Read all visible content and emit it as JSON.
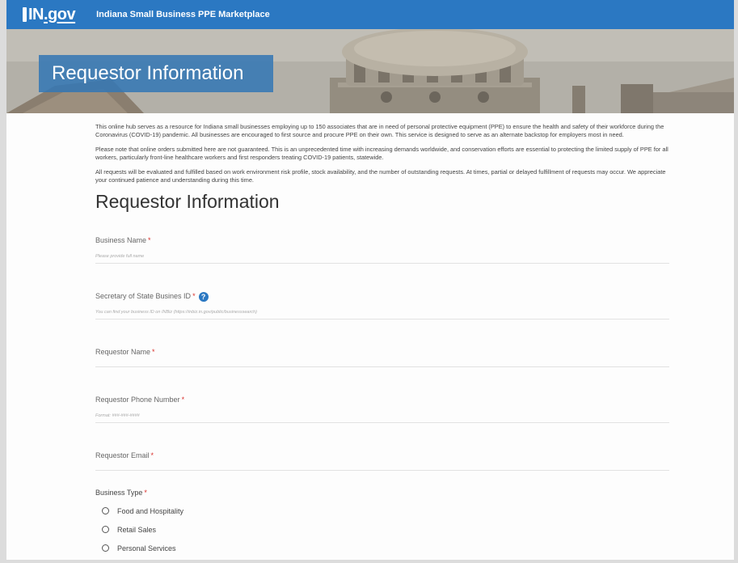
{
  "header": {
    "logo_prefix": "IN",
    "logo_suffix": ".gov",
    "site_title": "Indiana Small Business PPE Marketplace"
  },
  "hero": {
    "title": "Requestor Information"
  },
  "intro": {
    "p1": "This online hub serves as a resource for Indiana small businesses employing up to 150 associates that are in need of personal protective equipment (PPE) to ensure the health and safety of their workforce during the Coronavirus (COVID-19) pandemic. All businesses are encouraged to first source and procure PPE on their own. This service is designed to serve as an alternate backstop for employers most in need.",
    "p2": "Please note that online orders submitted here are not guaranteed. This is an unprecedented time with increasing demands worldwide, and conservation efforts are essential to protecting the limited supply of PPE for all workers, particularly front-line healthcare workers and first responders treating COVID-19 patients, statewide.",
    "p3": "All requests will be evaluated and fulfilled based on work environment risk profile, stock availability, and the number of outstanding requests. At times, partial or delayed fulfillment of requests may occur. We appreciate your continued patience and understanding during this time."
  },
  "form": {
    "heading": "Requestor Information",
    "required_marker": "*",
    "help_icon_glyph": "?",
    "fields": {
      "business_name": {
        "label": "Business Name",
        "hint": "Please provide full name"
      },
      "sos_id": {
        "label": "Secretary of State Busines ID",
        "hint": "You can find your business ID on INBiz (https://inbiz.in.gov/public/businesssearch)"
      },
      "requestor_name": {
        "label": "Requestor Name"
      },
      "requestor_phone": {
        "label": "Requestor Phone Number",
        "hint": "Format: ###-###-####"
      },
      "requestor_email": {
        "label": "Requestor Email"
      }
    },
    "business_type": {
      "label": "Business Type",
      "options": [
        "Food and Hospitality",
        "Retail Sales",
        "Personal Services"
      ]
    }
  },
  "colors": {
    "header_blue": "#2b78c2",
    "hero_banner": "#3678b4",
    "required_red": "#d9302b"
  }
}
